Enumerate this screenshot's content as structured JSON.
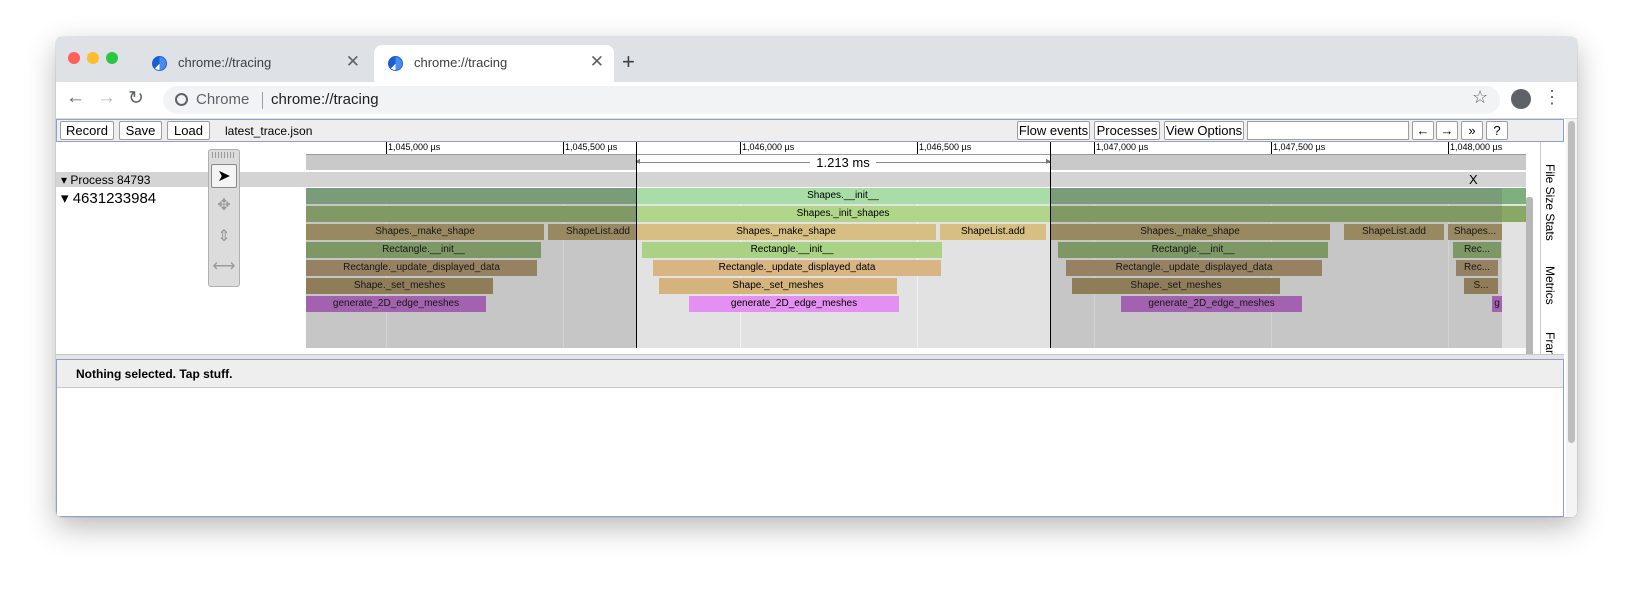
{
  "browser": {
    "tabs": [
      {
        "title": "chrome://tracing",
        "active": false
      },
      {
        "title": "chrome://tracing",
        "active": true
      }
    ],
    "omnibox": {
      "security_label": "Chrome",
      "url": "chrome://tracing"
    }
  },
  "tracing": {
    "controls": {
      "record": "Record",
      "save": "Save",
      "load": "Load",
      "filename": "latest_trace.json",
      "flow_events": "Flow events",
      "processes": "Processes",
      "view_options": "View Options",
      "search_placeholder": "",
      "prev": "←",
      "next": "→",
      "more": "»",
      "help": "?"
    },
    "side_tabs": [
      "File Size Stats",
      "Metrics",
      "Frame"
    ],
    "ruler_labels": [
      "1,045,000 µs",
      "1,045,500 µs",
      "1,046,000 µs",
      "1,046,500 µs",
      "1,047,000 µs",
      "1,047,500 µs",
      "1,048,000 µs"
    ],
    "selection_duration": "1.213 ms",
    "process": "Process 84793",
    "thread": "4631233984",
    "close": "X",
    "slices": {
      "s1": "Shapes.__init__",
      "s2": "Shapes._init_shapes",
      "s3": "Shapes._make_shape",
      "s4": "ShapeList.add",
      "s5": "Shapes._make_shape",
      "s6": "ShapeList.add",
      "s7": "Shapes._make_shape",
      "s8": "ShapeList.add",
      "s9": "Shapes...",
      "s10": "Rectangle.__init__",
      "s11": "Rectangle.__init__",
      "s12": "Rectangle.__init__",
      "s13": "Rec...",
      "s14": "Rectangle._update_displayed_data",
      "s15": "Rectangle._update_displayed_data",
      "s16": "Rectangle._update_displayed_data",
      "s17": "Rec...",
      "s18": "Shape._set_meshes",
      "s19": "Shape._set_meshes",
      "s20": "Shape._set_meshes",
      "s21": "S...",
      "s22": "generate_2D_edge_meshes",
      "s23": "generate_2D_edge_meshes",
      "s24": "generate_2D_edge_meshes",
      "s25": "g"
    },
    "analysis_message": "Nothing selected. Tap stuff."
  }
}
